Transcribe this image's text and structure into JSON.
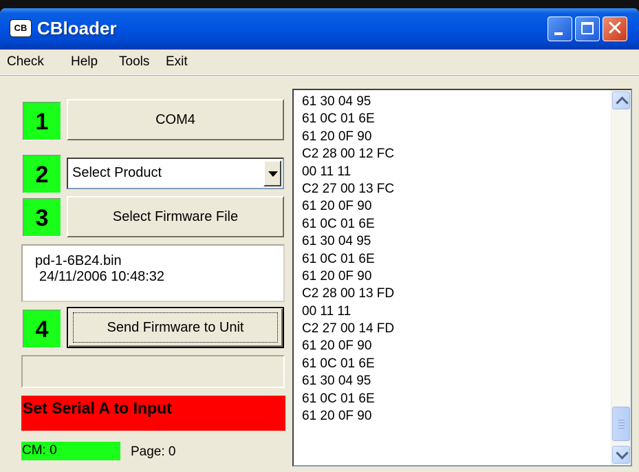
{
  "window": {
    "title": "CBloader",
    "icon_text": "CB",
    "icon": "cbloader-app-icon",
    "controls": [
      "minimize-icon",
      "maximize-icon",
      "close-icon"
    ],
    "close_glyph": "✕"
  },
  "menu": {
    "items": [
      {
        "label": "Check"
      },
      {
        "label": "Help"
      },
      {
        "label": "Tools"
      },
      {
        "label": "Exit"
      }
    ]
  },
  "steps": {
    "step1": {
      "number": "1",
      "button_label": "COM4"
    },
    "step2": {
      "number": "2",
      "select_value": "Select Product"
    },
    "step3": {
      "number": "3",
      "button_label": "Select Firmware File"
    },
    "step4": {
      "number": "4",
      "button_label": "Send Firmware to Unit"
    }
  },
  "file_info": {
    "filename": "pd-1-6B24.bin",
    "timestamp": "24/11/2006 10:48:32"
  },
  "progress": {
    "value": 0
  },
  "status": {
    "message": "Set Serial A to Input",
    "color": "#ff0000"
  },
  "counters": {
    "cm_label": "CM: 0",
    "page_label": "Page: 0",
    "cm_color": "#19ff19"
  },
  "colors": {
    "step_green": "#19ff19",
    "titlebar_blue": "#0054e3",
    "window_bg": "#ece9d8"
  },
  "log": {
    "lines": [
      "61 30 04 95",
      "61 0C 01 6E",
      "61 20 0F 90",
      "C2 28 00 12 FC",
      "00 11 11",
      "C2 27 00 13 FC",
      "61 20 0F 90",
      "61 0C 01 6E",
      "61 30 04 95",
      "61 0C 01 6E",
      "61 20 0F 90",
      "C2 28 00 13 FD",
      "00 11 11",
      "C2 27 00 14 FD",
      "61 20 0F 90",
      "61 0C 01 6E",
      "61 30 04 95",
      "61 0C 01 6E",
      "61 20 0F 90"
    ]
  }
}
